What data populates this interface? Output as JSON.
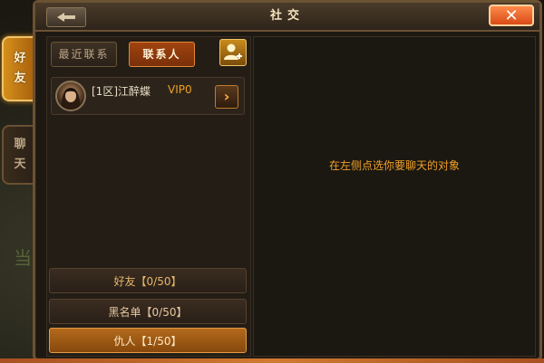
{
  "window": {
    "title": "社交",
    "close_label": "✕"
  },
  "side_tabs": [
    {
      "line1": "好",
      "line2": "友"
    },
    {
      "line1": "聊",
      "line2": "天"
    }
  ],
  "background": {
    "char": "当"
  },
  "tabs": {
    "recent": "最近联系",
    "contacts": "联系人"
  },
  "contact": {
    "name": "[1区]江醉蝶",
    "vip": "VIP0",
    "arrow": "›"
  },
  "lists": {
    "friends": "好友【0/50】",
    "blacklist": "黑名单【0/50】",
    "enemies": "仇人【1/50】"
  },
  "right_panel": {
    "hint": "在左侧点选你要聊天的对象"
  },
  "colors": {
    "accent_orange": "#f0a028",
    "frame_brown": "#6b5232",
    "close_red": "#d84a16"
  }
}
